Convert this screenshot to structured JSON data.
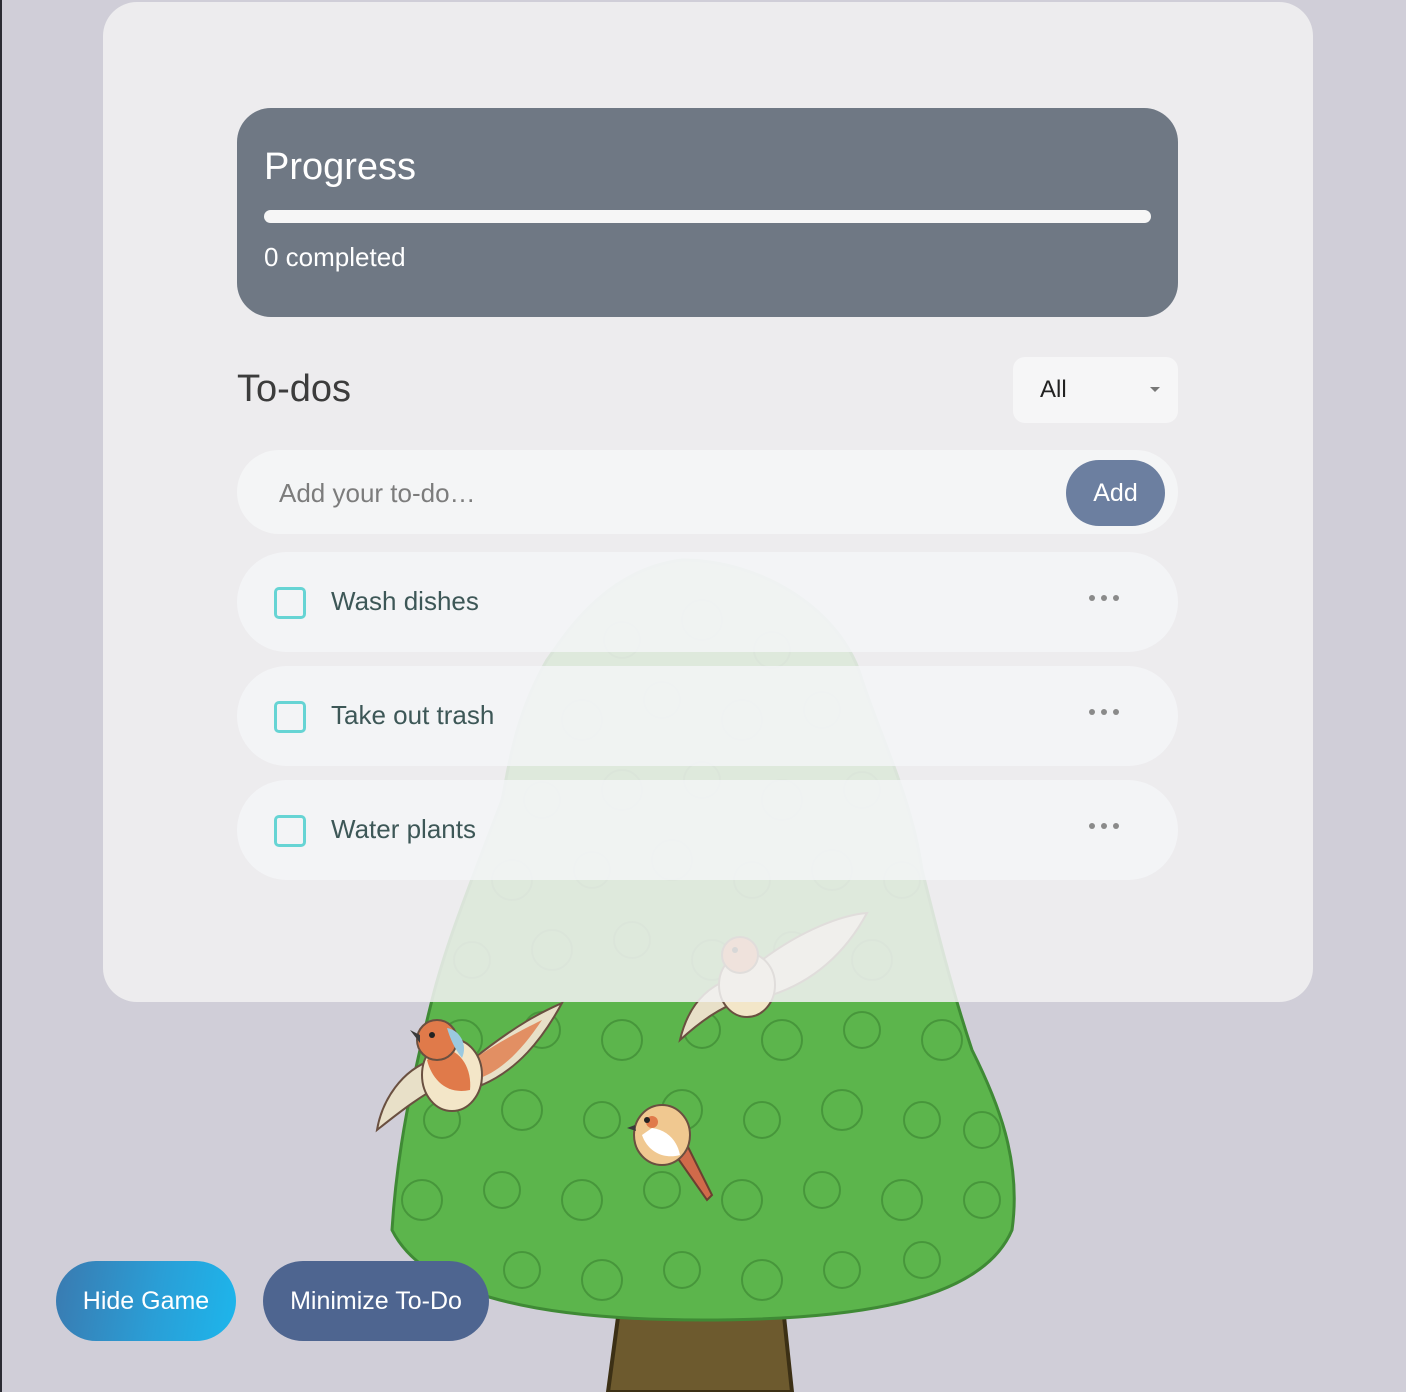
{
  "progress": {
    "title": "Progress",
    "completed_text": "0 completed",
    "fraction_complete": 0
  },
  "todos": {
    "title": "To-dos",
    "filter": {
      "selected": "All"
    },
    "add_input": {
      "placeholder": "Add your to-do…",
      "value": ""
    },
    "add_button_label": "Add",
    "items": [
      {
        "label": "Wash dishes",
        "checked": false
      },
      {
        "label": "Take out trash",
        "checked": false
      },
      {
        "label": "Water plants",
        "checked": false
      }
    ]
  },
  "buttons": {
    "hide_game": "Hide Game",
    "minimize_todo": "Minimize To-Do"
  },
  "colors": {
    "background": "#d0ced8",
    "progress_card": "#6f7884",
    "accent_checkbox": "#66d4d4",
    "add_button": "#6c7fa0",
    "minimize_button": "#4e6590",
    "hide_button_gradient_start": "#3a7ab0",
    "hide_button_gradient_end": "#1db6ec",
    "foliage": "#5cb54c",
    "trunk": "#6d5a2e"
  }
}
